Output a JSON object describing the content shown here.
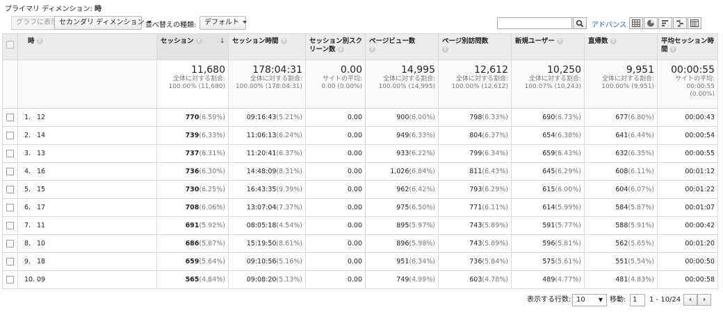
{
  "header": {
    "primary_dimension_label": "プライマリ ディメンション:",
    "primary_dimension_value": "時"
  },
  "toolbar": {
    "graph_button": "グラフに表示",
    "secondary_dimension": "セカンダリ ディメンション",
    "sort_type_label": "並べ替えの種類:",
    "sort_type_value": "デフォルト",
    "search_placeholder": "",
    "advanced_link": "アドバンス"
  },
  "table": {
    "columns": [
      {
        "label": "時"
      },
      {
        "label": "セッション"
      },
      {
        "label": "セッション時間"
      },
      {
        "label": "セッション別スクリーン数"
      },
      {
        "label": "ページビュー数"
      },
      {
        "label": "ページ別訪問数"
      },
      {
        "label": "新規ユーザー"
      },
      {
        "label": "直帰数"
      },
      {
        "label": "平均セッション時間"
      }
    ],
    "totals": [
      {
        "value": "11,680",
        "sub1": "全体に対する割合:",
        "sub2": "100.00% (11,680)"
      },
      {
        "value": "178:04:31",
        "sub1": "全体に対する割合:",
        "sub2": "100.00% (178:04:31)"
      },
      {
        "value": "0.00",
        "sub1": "サイトの平均:",
        "sub2": "0.00 (0.00%)"
      },
      {
        "value": "14,995",
        "sub1": "全体に対する割合:",
        "sub2": "100.00% (14,995)"
      },
      {
        "value": "12,612",
        "sub1": "全体に対する割合:",
        "sub2": "100.00% (12,612)"
      },
      {
        "value": "10,250",
        "sub1": "全体に対する割合:",
        "sub2": "100.07% (10,243)"
      },
      {
        "value": "9,951",
        "sub1": "全体に対する割合:",
        "sub2": "100.00% (9,951)"
      },
      {
        "value": "00:00:55",
        "sub1": "サイトの平均:",
        "sub2": "00:00:55",
        "sub3": "(0.00%)"
      }
    ],
    "rows": [
      {
        "idx": "1.",
        "hour": "12",
        "sessions": "770",
        "sessions_pct": "(6.59%)",
        "duration": "09:16:43",
        "duration_pct": "(5.21%)",
        "screens": "0.00",
        "pageviews": "900",
        "pageviews_pct": "(6.00%)",
        "visits": "798",
        "visits_pct": "(6.33%)",
        "new_users": "690",
        "new_users_pct": "(6.73%)",
        "bounces": "677",
        "bounces_pct": "(6.80%)",
        "avg": "00:00:43"
      },
      {
        "idx": "2.",
        "hour": "14",
        "sessions": "739",
        "sessions_pct": "(6.33%)",
        "duration": "11:06:13",
        "duration_pct": "(6.24%)",
        "screens": "0.00",
        "pageviews": "949",
        "pageviews_pct": "(6.33%)",
        "visits": "804",
        "visits_pct": "(6.37%)",
        "new_users": "654",
        "new_users_pct": "(6.38%)",
        "bounces": "641",
        "bounces_pct": "(6.44%)",
        "avg": "00:00:54"
      },
      {
        "idx": "3.",
        "hour": "13",
        "sessions": "737",
        "sessions_pct": "(6.31%)",
        "duration": "11:20:41",
        "duration_pct": "(6.37%)",
        "screens": "0.00",
        "pageviews": "933",
        "pageviews_pct": "(6.22%)",
        "visits": "799",
        "visits_pct": "(6.34%)",
        "new_users": "659",
        "new_users_pct": "(6.43%)",
        "bounces": "632",
        "bounces_pct": "(6.35%)",
        "avg": "00:00:55"
      },
      {
        "idx": "4.",
        "hour": "16",
        "sessions": "736",
        "sessions_pct": "(6.30%)",
        "duration": "14:48:09",
        "duration_pct": "(8.31%)",
        "screens": "0.00",
        "pageviews": "1,026",
        "pageviews_pct": "(6.84%)",
        "visits": "811",
        "visits_pct": "(6.43%)",
        "new_users": "645",
        "new_users_pct": "(6.29%)",
        "bounces": "608",
        "bounces_pct": "(6.11%)",
        "avg": "00:01:12"
      },
      {
        "idx": "5.",
        "hour": "15",
        "sessions": "730",
        "sessions_pct": "(6.25%)",
        "duration": "16:43:35",
        "duration_pct": "(9.39%)",
        "screens": "0.00",
        "pageviews": "962",
        "pageviews_pct": "(6.42%)",
        "visits": "793",
        "visits_pct": "(6.29%)",
        "new_users": "615",
        "new_users_pct": "(6.00%)",
        "bounces": "604",
        "bounces_pct": "(6.07%)",
        "avg": "00:01:22"
      },
      {
        "idx": "6.",
        "hour": "17",
        "sessions": "708",
        "sessions_pct": "(6.06%)",
        "duration": "13:07:04",
        "duration_pct": "(7.37%)",
        "screens": "0.00",
        "pageviews": "975",
        "pageviews_pct": "(6.50%)",
        "visits": "771",
        "visits_pct": "(6.11%)",
        "new_users": "614",
        "new_users_pct": "(5.99%)",
        "bounces": "584",
        "bounces_pct": "(5.87%)",
        "avg": "00:01:07"
      },
      {
        "idx": "7.",
        "hour": "11",
        "sessions": "691",
        "sessions_pct": "(5.92%)",
        "duration": "08:05:18",
        "duration_pct": "(4.54%)",
        "screens": "0.00",
        "pageviews": "895",
        "pageviews_pct": "(5.97%)",
        "visits": "743",
        "visits_pct": "(5.89%)",
        "new_users": "591",
        "new_users_pct": "(5.77%)",
        "bounces": "588",
        "bounces_pct": "(5.91%)",
        "avg": "00:00:42"
      },
      {
        "idx": "8.",
        "hour": "10",
        "sessions": "686",
        "sessions_pct": "(5.87%)",
        "duration": "15:19:50",
        "duration_pct": "(8.61%)",
        "screens": "0.00",
        "pageviews": "896",
        "pageviews_pct": "(5.98%)",
        "visits": "743",
        "visits_pct": "(5.89%)",
        "new_users": "596",
        "new_users_pct": "(5.81%)",
        "bounces": "562",
        "bounces_pct": "(5.65%)",
        "avg": "00:01:20"
      },
      {
        "idx": "9.",
        "hour": "18",
        "sessions": "659",
        "sessions_pct": "(5.64%)",
        "duration": "09:10:56",
        "duration_pct": "(5.16%)",
        "screens": "0.00",
        "pageviews": "951",
        "pageviews_pct": "(6.34%)",
        "visits": "736",
        "visits_pct": "(5.84%)",
        "new_users": "575",
        "new_users_pct": "(5.61%)",
        "bounces": "551",
        "bounces_pct": "(5.54%)",
        "avg": "00:00:50"
      },
      {
        "idx": "10.",
        "hour": "09",
        "sessions": "565",
        "sessions_pct": "(4.84%)",
        "duration": "09:08:20",
        "duration_pct": "(5.13%)",
        "screens": "0.00",
        "pageviews": "749",
        "pageviews_pct": "(4.99%)",
        "visits": "603",
        "visits_pct": "(4.78%)",
        "new_users": "489",
        "new_users_pct": "(4.77%)",
        "bounces": "481",
        "bounces_pct": "(4.83%)",
        "avg": "00:00:58"
      }
    ]
  },
  "pagination": {
    "rows_label": "表示する行数:",
    "rows_value": "10",
    "goto_label": "移動:",
    "goto_value": "1",
    "range": "1 - 10/24",
    "prev_glyph": "‹",
    "next_glyph": "›"
  }
}
